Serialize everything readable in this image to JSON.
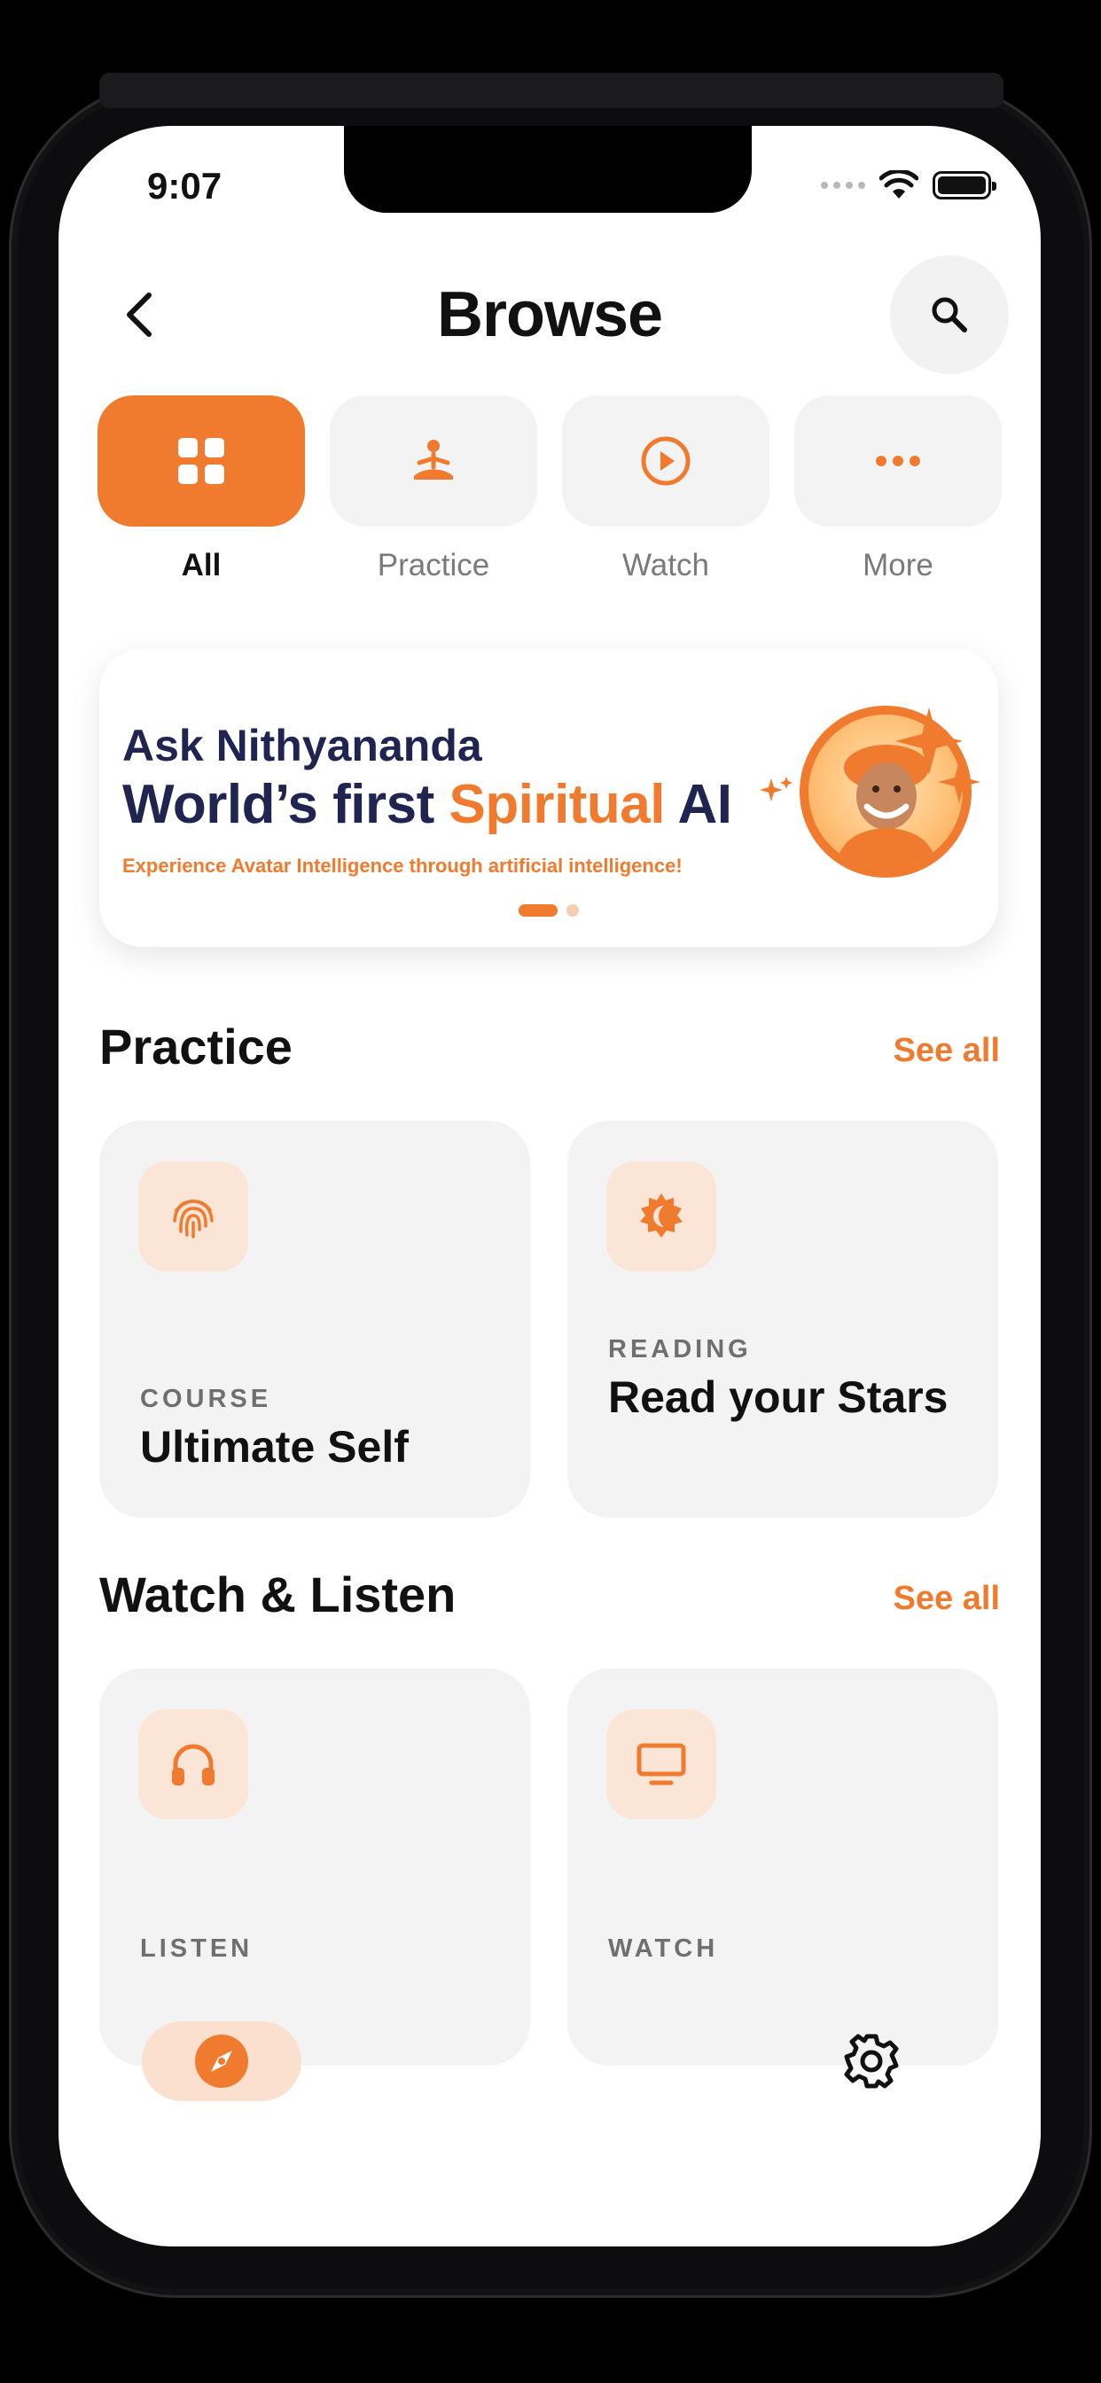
{
  "status_bar": {
    "time": "9:07"
  },
  "header": {
    "title": "Browse"
  },
  "icons": {
    "back": "chevron-left-icon",
    "search": "search-icon",
    "all": "grid-icon",
    "practice": "meditation-icon",
    "watch": "play-circle-icon",
    "more": "more-dots-icon",
    "fingerprint": "fingerprint-icon",
    "reading": "sun-moon-icon",
    "listen": "headphones-icon",
    "watch_card": "monitor-icon",
    "explore": "compass-icon",
    "settings": "gear-icon"
  },
  "tabs": [
    {
      "label": "All",
      "active": true
    },
    {
      "label": "Practice",
      "active": false
    },
    {
      "label": "Watch",
      "active": false
    },
    {
      "label": "More",
      "active": false
    }
  ],
  "banner": {
    "line1": "Ask Nithyananda",
    "line2_prefix": "World’s first ",
    "line2_accent": "Spiritual",
    "line2_suffix": " AI",
    "subtitle": "Experience Avatar Intelligence through artificial intelligence!",
    "page_count": 2,
    "active_page": 1
  },
  "practice": {
    "title": "Practice",
    "see_all": "See all",
    "cards": [
      {
        "kicker": "COURSE",
        "title": "Ultimate Self"
      },
      {
        "kicker": "READING",
        "title": "Read your Stars"
      }
    ]
  },
  "watch_listen": {
    "title": "Watch & Listen",
    "see_all": "See all",
    "cards": [
      {
        "kicker": "LISTEN"
      },
      {
        "kicker": "WATCH"
      }
    ]
  },
  "colors": {
    "accent": "#f07b2f",
    "accent_soft": "#fbe5d6",
    "navy": "#1f2451",
    "card_bg": "#f3f3f3"
  }
}
